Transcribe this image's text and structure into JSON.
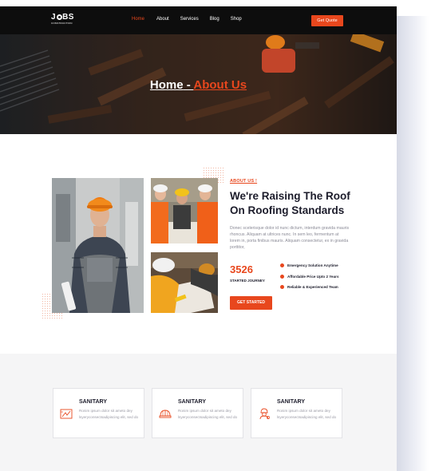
{
  "nav": {
    "logo": {
      "text_before": "J",
      "text_after": "BS",
      "subtitle": "CONSTRUCTION"
    },
    "menu": [
      {
        "label": "Home",
        "active": true
      },
      {
        "label": "About",
        "active": false
      },
      {
        "label": "Services",
        "active": false
      },
      {
        "label": "Blog",
        "active": false
      },
      {
        "label": "Shop",
        "active": false
      }
    ],
    "cta_label": "Get Quote"
  },
  "hero": {
    "home_label": "Home",
    "separator": " - ",
    "current_label": "About Us"
  },
  "about": {
    "tag": "ABOUT US !",
    "heading": "We're Raising The Roof On Roofing Standards",
    "text": "Donec scelerisque dolor id nunc dictum, interdum gravida mauris rhoncus. Aliquam at ultrices nunc. In sem leo, fermentum at lorem in, porta finibus mauris. Aliquam consectetur, ex in gravida porttitor,",
    "stat_number": "3526",
    "stat_label": "STARTED JOURNEY",
    "features": [
      "Emergency Solution Anytime",
      "Affordable Price Upto 2 Years",
      "Reliable & Experienced Team"
    ],
    "button_label": "GET STARTED"
  },
  "services": [
    {
      "title": "SANITARY",
      "desc": "Ronim ipsum dolor sit ameto dey lsyeryconsectsadipiscing elit, sed do",
      "icon": "blueprint-icon"
    },
    {
      "title": "SANITARY",
      "desc": "Ronim ipsum dolor sit ameto dey lsyeryconsectsadipiscing elit, sed do",
      "icon": "hard-hat-icon"
    },
    {
      "title": "SANITARY",
      "desc": "Ronim ipsum dolor sit ameto dey lsyeryconsectsadipiscing elit, sed do",
      "icon": "worker-icon"
    }
  ],
  "colors": {
    "accent": "#e8471d",
    "dark": "#0d0d0d",
    "heading": "#1c1c2b"
  }
}
